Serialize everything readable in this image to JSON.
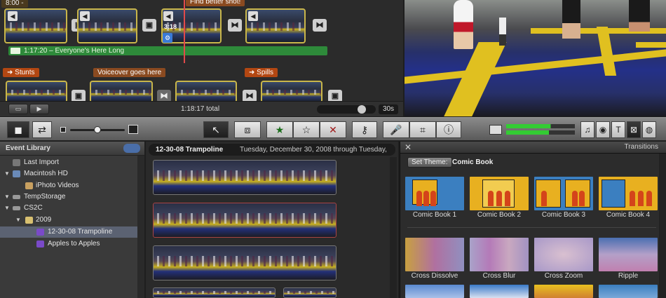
{
  "project": {
    "top_tag": "8:00 -",
    "find_tag": "Find better shot!",
    "clip_time": "3:18",
    "music_bar": "1:17:20 – Everyone's Here Long",
    "tags_row2": [
      "Stunts",
      "Voiceover goes here",
      "Spills"
    ],
    "total": "1:18:17 total",
    "zoom_label": "30s"
  },
  "toolbar": {
    "tools": [
      "camera-icon",
      "swap-icon",
      "arrow-icon",
      "crop-select-icon",
      "star-filled-icon",
      "star-empty-icon",
      "reject-icon",
      "keyword-icon",
      "voiceover-icon",
      "crop-icon",
      "info-icon",
      "music-icon",
      "photo-icon",
      "title-icon",
      "transition-icon",
      "map-icon"
    ]
  },
  "library": {
    "title": "Event Library",
    "items": [
      {
        "label": "Last Import",
        "indent": 0
      },
      {
        "label": "Macintosh HD",
        "indent": 0
      },
      {
        "label": "iPhoto Videos",
        "indent": 1
      },
      {
        "label": "TempStorage",
        "indent": 0
      },
      {
        "label": "CS2C",
        "indent": 0
      },
      {
        "label": "2009",
        "indent": 1
      },
      {
        "label": "12-30-08 Trampoline",
        "indent": 2
      },
      {
        "label": "Apples to Apples",
        "indent": 2
      }
    ]
  },
  "browser": {
    "event_name": "12-30-08 Trampoline",
    "event_dates": "Tuesday, December 30, 2008 through Tuesday,"
  },
  "transitions": {
    "title": "Transitions",
    "set_theme": "Set Theme:",
    "theme_name": "Comic Book",
    "row1": [
      "Comic Book 1",
      "Comic Book 2",
      "Comic Book 3",
      "Comic Book 4"
    ],
    "row2": [
      "Cross Dissolve",
      "Cross Blur",
      "Cross Zoom",
      "Ripple"
    ]
  },
  "colors": {
    "selection": "#5b6272",
    "audio_green": "#2e8a3a",
    "marker_orange": "#b34712",
    "clip_border": "#c9b64a"
  }
}
